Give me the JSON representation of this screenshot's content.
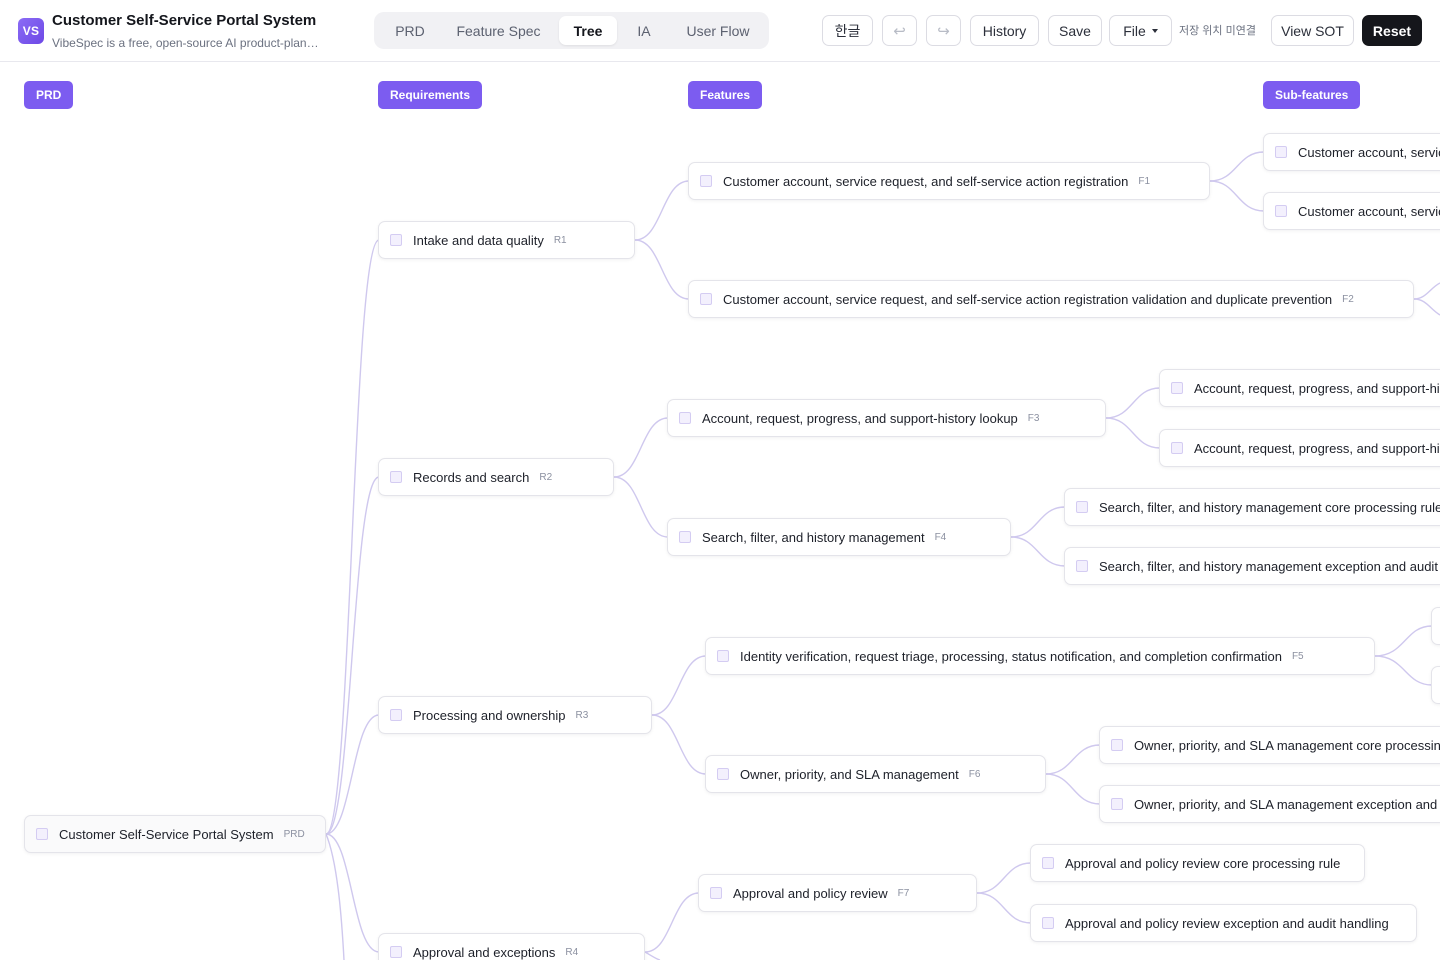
{
  "app": {
    "logo_text": "VS",
    "title": "Customer Self-Service Portal System",
    "subtitle": "VibeSpec is a free, open-source AI product-planning tool"
  },
  "tabs": [
    {
      "label": "PRD",
      "active": false
    },
    {
      "label": "Feature Spec",
      "active": false
    },
    {
      "label": "Tree",
      "active": true
    },
    {
      "label": "IA",
      "active": false
    },
    {
      "label": "User Flow",
      "active": false
    }
  ],
  "toolbar": {
    "language_label": "한글",
    "undo_icon": "↩",
    "redo_icon": "↪",
    "history_label": "History",
    "save_label": "Save",
    "file_label": "File",
    "save_location_status": "저장 위치 미연결",
    "view_sot_label": "View SOT",
    "reset_label": "Reset"
  },
  "tree": {
    "columns": [
      "PRD",
      "Requirements",
      "Features",
      "Sub-features"
    ],
    "root": {
      "label": "Customer Self-Service Portal System",
      "code": "PRD"
    },
    "requirements": [
      {
        "label": "Intake and data quality",
        "code": "R1"
      },
      {
        "label": "Records and search",
        "code": "R2"
      },
      {
        "label": "Processing and ownership",
        "code": "R3"
      },
      {
        "label": "Approval and exceptions",
        "code": "R4"
      }
    ],
    "features": [
      {
        "label": "Customer account, service request, and self-service action registration",
        "code": "F1"
      },
      {
        "label": "Customer account, service request, and self-service action registration validation and duplicate prevention",
        "code": "F2"
      },
      {
        "label": "Account, request, progress, and support-history lookup",
        "code": "F3"
      },
      {
        "label": "Search, filter, and history management",
        "code": "F4"
      },
      {
        "label": "Identity verification, request triage, processing, status notification, and completion confirmation",
        "code": "F5"
      },
      {
        "label": "Owner, priority, and SLA management",
        "code": "F6"
      },
      {
        "label": "Approval and policy review",
        "code": "F7"
      }
    ],
    "subfeatures": [
      {
        "label": "Customer account, service request, and self-service action registration core processing rule"
      },
      {
        "label": "Customer account, service request, and self-service action registration exception and audit handling"
      },
      {
        "label": "Account, request, progress, and support-history lookup core processing rule"
      },
      {
        "label": "Account, request, progress, and support-history lookup exception and audit handling"
      },
      {
        "label": "Search, filter, and history management core processing rule"
      },
      {
        "label": "Search, filter, and history management exception and audit handling"
      },
      {
        "label": "Owner, priority, and SLA management core processing rule"
      },
      {
        "label": "Owner, priority, and SLA management exception and audit handling"
      },
      {
        "label": "Approval and policy review core processing rule"
      },
      {
        "label": "Approval and policy review exception and audit handling"
      }
    ]
  }
}
